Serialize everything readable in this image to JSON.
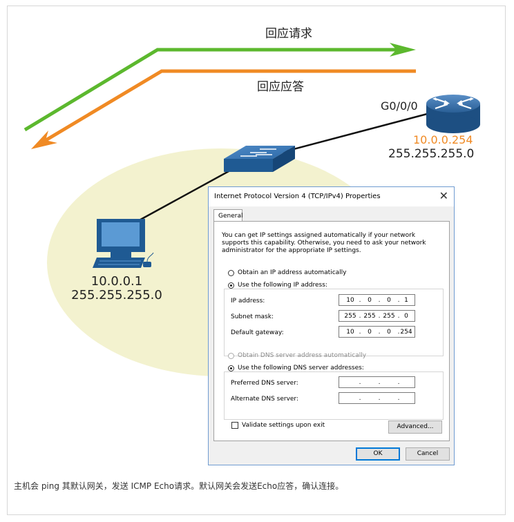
{
  "arrows": {
    "request_label": "回应请求",
    "reply_label": "回应应答",
    "request_color": "#5cb82e",
    "reply_color": "#f08a24"
  },
  "router": {
    "port": "G0/0/0",
    "ip": "10.0.0.254",
    "mask": "255.255.255.0",
    "icon": "router-icon"
  },
  "host": {
    "ip": "10.0.0.1",
    "mask": "255.255.255.0",
    "icon": "pc-icon"
  },
  "switch": {
    "icon": "switch-icon"
  },
  "dialog": {
    "title": "Internet Protocol Version 4 (TCP/IPv4) Properties",
    "close": "✕",
    "tab": "General",
    "description": "You can get IP settings assigned automatically if your network supports this capability. Otherwise, you need to ask your network administrator for the appropriate IP settings.",
    "ip_auto": "Obtain an IP address automatically",
    "ip_manual": "Use the following IP address:",
    "ip_label": "IP address:",
    "ip_value": [
      "10",
      "0",
      "0",
      "1"
    ],
    "mask_label": "Subnet mask:",
    "mask_value": [
      "255",
      "255",
      "255",
      "0"
    ],
    "gw_label": "Default gateway:",
    "gw_value": [
      "10",
      "0",
      "0",
      "254"
    ],
    "dns_auto": "Obtain DNS server address automatically",
    "dns_manual": "Use the following DNS server addresses:",
    "dns_pref_label": "Preferred DNS server:",
    "dns_alt_label": "Alternate DNS server:",
    "validate": "Validate settings upon exit",
    "advanced": "Advanced...",
    "ok": "OK",
    "cancel": "Cancel"
  },
  "caption": "主机会 ping 其默认网关，发送 ICMP Echo请求。默认网关会发送Echo应答，确认连接。"
}
